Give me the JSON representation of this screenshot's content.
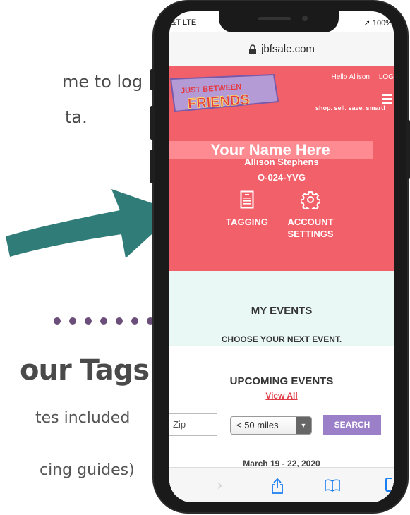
{
  "slide": {
    "line1": "me to log",
    "line2": "ta.",
    "heading": "our Tags",
    "sub1": "tes included",
    "sub2": "cing guides)"
  },
  "status": {
    "carrier": "&T  LTE",
    "battery": "➚ 100%"
  },
  "browser": {
    "url": "jbfsale.com"
  },
  "header": {
    "logo_line1": "JUST BETWEEN",
    "logo_line2": "FRIENDS",
    "hello": "Hello Allison",
    "logout": "LOG",
    "tagline": "shop. sell. save. smart!"
  },
  "account": {
    "overlay": "Your Name Here",
    "name": "Allison Stephens",
    "id": "O-024-YVG",
    "tiles": [
      {
        "label": "TAGGING",
        "icon": "document-icon"
      },
      {
        "label": "ACCOUNT SETTINGS",
        "icon": "gear-icon"
      }
    ]
  },
  "events": {
    "title": "MY EVENTS",
    "subtitle": "CHOOSE YOUR NEXT EVENT."
  },
  "upcoming": {
    "title": "UPCOMING EVENTS",
    "view_all": "View All",
    "zip_placeholder": "Zip",
    "distance": "< 50 miles",
    "search": "SEARCH",
    "date_peek": "March 19 - 22, 2020"
  },
  "colors": {
    "brand_red": "#f2606a",
    "teal_arrow": "#2f7c78",
    "search_purple": "#9b7fc8",
    "events_bg": "#e9f7f5"
  }
}
